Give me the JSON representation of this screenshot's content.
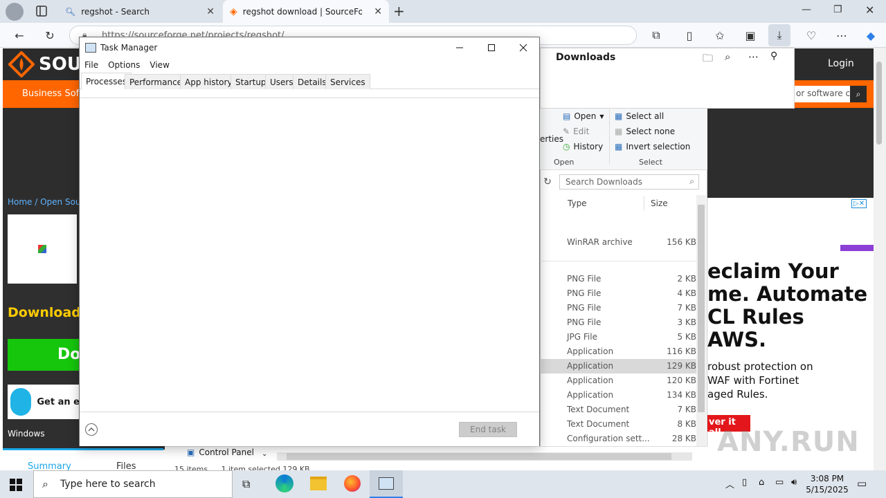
{
  "browser": {
    "tabs": [
      {
        "label": "regshot - Search"
      },
      {
        "label": "regshot download | SourceForge"
      }
    ],
    "url": "https://sourceforge.net/projects/regshot/"
  },
  "downloads_panel": {
    "title": "Downloads"
  },
  "sourceforge": {
    "logo": "SOURCE",
    "nav_business": "Business Soft",
    "login": "Login",
    "search_placeholder": "or software c",
    "breadcrumb": "Home / Open Sourc",
    "downloads_heading": "Downloads:",
    "download_button": "Do",
    "newsletter": "Get an e",
    "windows": "Windows",
    "tab_summary": "Summary",
    "tab_files": "Files"
  },
  "ad": {
    "line1": "eclaim Your",
    "line2": "me. Automate",
    "line3": "CL Rules",
    "line4": "AWS.",
    "sub1": "robust protection on",
    "sub2": "WAF with Fortinet",
    "sub3": "aged Rules.",
    "cta": "ver it all",
    "watermark": "ANY.RUN"
  },
  "task_manager": {
    "title": "Task Manager",
    "menu": [
      "File",
      "Options",
      "View"
    ],
    "tabs": [
      "Processes",
      "Performance",
      "App history",
      "Startup",
      "Users",
      "Details",
      "Services"
    ],
    "end_task": "End task"
  },
  "explorer": {
    "ribbon": {
      "open": "Open",
      "edit": "Edit",
      "history": "History",
      "properties": "erties",
      "select_all": "Select all",
      "select_none": "Select none",
      "invert_selection": "Invert selection",
      "group_open": "Open",
      "group_select": "Select"
    },
    "search_placeholder": "Search Downloads",
    "col_type": "Type",
    "col_size": "Size",
    "files": [
      {
        "type": "WinRAR archive",
        "size": "156 KB"
      },
      {
        "type": "PNG File",
        "size": "2 KB"
      },
      {
        "type": "PNG File",
        "size": "4 KB"
      },
      {
        "type": "PNG File",
        "size": "7 KB"
      },
      {
        "type": "PNG File",
        "size": "3 KB"
      },
      {
        "type": "JPG File",
        "size": "5 KB"
      },
      {
        "type": "Application",
        "size": "116 KB"
      },
      {
        "type": "Application",
        "size": "129 KB"
      },
      {
        "type": "Application",
        "size": "120 KB"
      },
      {
        "type": "Application",
        "size": "134 KB"
      },
      {
        "type": "Text Document",
        "size": "7 KB"
      },
      {
        "type": "Text Document",
        "size": "8 KB"
      },
      {
        "type": "Configuration sett...",
        "size": "28 KB"
      }
    ],
    "nav_control_panel": "Control Panel",
    "status_items": "15 items",
    "status_selected": "1 item selected  129 KB"
  },
  "taskbar": {
    "search_placeholder": "Type here to search",
    "time": "3:08 PM",
    "date": "5/15/2025"
  }
}
